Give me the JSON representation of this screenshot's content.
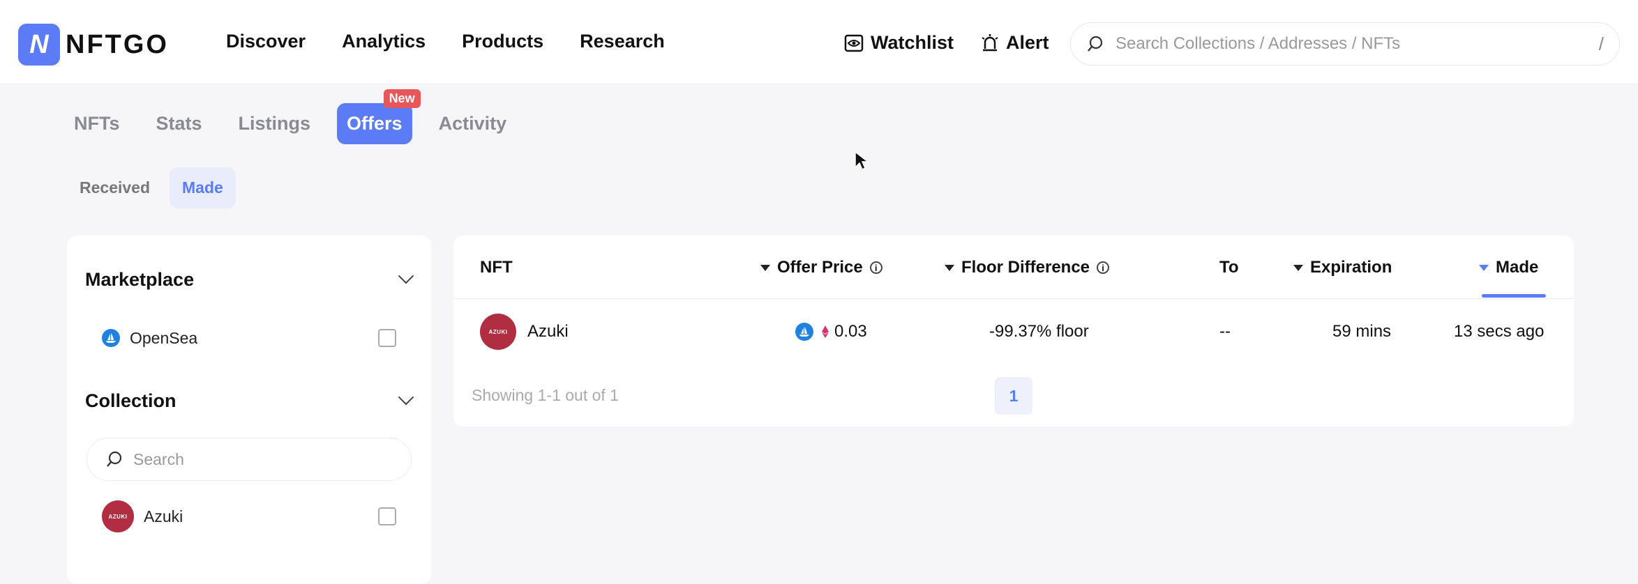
{
  "header": {
    "logo_text": "NFTGO",
    "nav": [
      "Discover",
      "Analytics",
      "Products",
      "Research"
    ],
    "watchlist_label": "Watchlist",
    "alert_label": "Alert",
    "search_placeholder": "Search Collections / Addresses / NFTs",
    "search_shortcut": "/"
  },
  "tabs": {
    "items": [
      "NFTs",
      "Stats",
      "Listings",
      "Offers",
      "Activity"
    ],
    "active": "Offers",
    "offers_badge": "New"
  },
  "subtabs": {
    "items": [
      "Received",
      "Made"
    ],
    "active": "Made"
  },
  "sidebar": {
    "marketplace_title": "Marketplace",
    "marketplace_option": "OpenSea",
    "collection_title": "Collection",
    "search_placeholder": "Search",
    "collection_option": "Azuki",
    "avatar_text": "AZUKI"
  },
  "table": {
    "columns": {
      "nft": "NFT",
      "offer_price": "Offer Price",
      "floor_difference": "Floor Difference",
      "to": "To",
      "expiration": "Expiration",
      "made": "Made"
    },
    "rows": [
      {
        "nft": "Azuki",
        "offer_price": "0.03",
        "floor_difference": "-99.37% floor",
        "to": "--",
        "expiration": "59 mins",
        "made": "13 secs ago"
      }
    ],
    "footer": "Showing 1-1 out of 1",
    "current_page": "1"
  },
  "colors": {
    "accent": "#5b7cf6",
    "badge": "#e8565a",
    "azuki": "#b12d41",
    "opensea": "#2081e2"
  }
}
